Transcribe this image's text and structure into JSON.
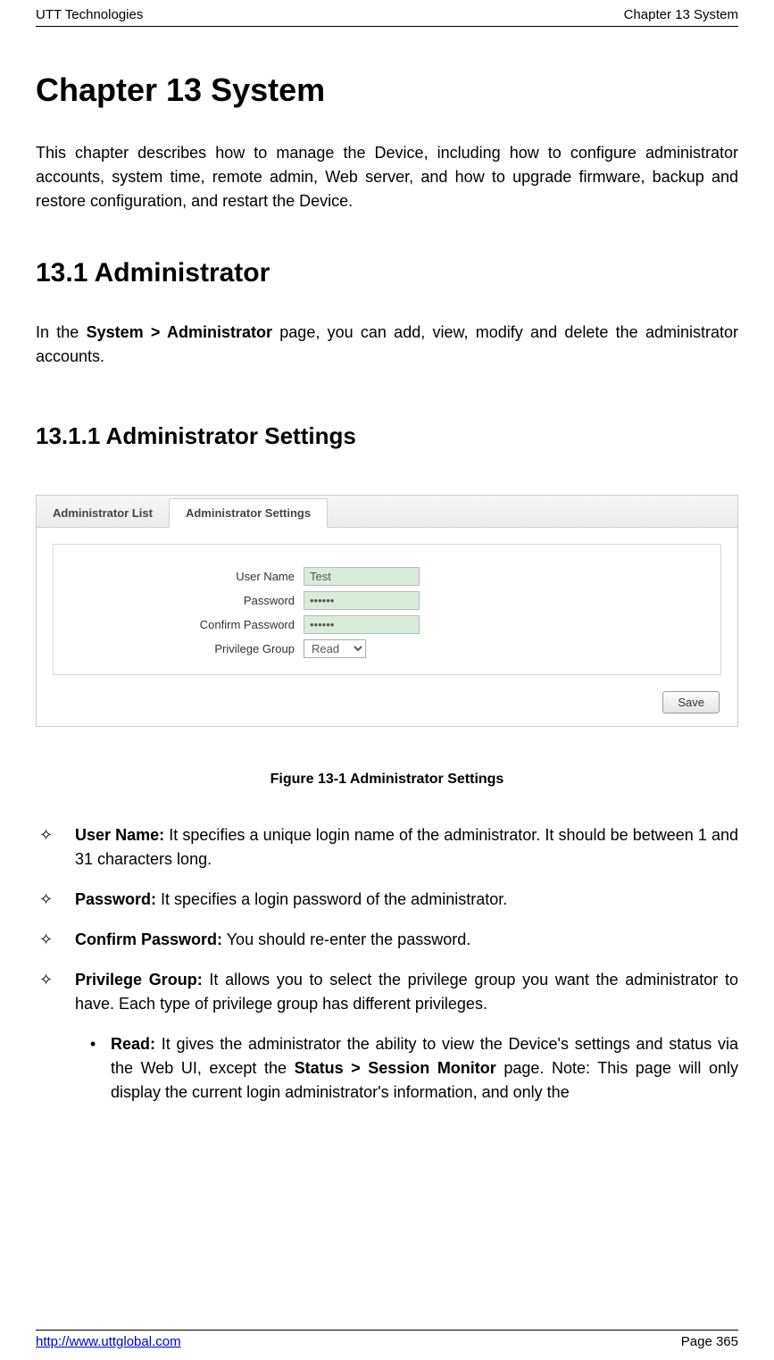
{
  "header": {
    "left": "UTT Technologies",
    "right": "Chapter 13 System"
  },
  "h1": "Chapter 13  System",
  "intro": "This chapter describes how to manage the Device, including how to configure administrator accounts, system time, remote admin, Web server, and how to upgrade firmware, backup and restore configuration, and restart the Device.",
  "h2": "13.1   Administrator",
  "section_intro_pre": "In the ",
  "section_intro_bold": "System > Administrator",
  "section_intro_post": " page, you can add, view, modify and delete the administrator accounts.",
  "h3": "13.1.1  Administrator Settings",
  "widget": {
    "tabs": {
      "list": "Administrator List",
      "settings": "Administrator Settings"
    },
    "fields": {
      "username_label": "User Name",
      "username_value": "Test",
      "password_label": "Password",
      "password_value": "••••••",
      "confirm_label": "Confirm Password",
      "confirm_value": "••••••",
      "group_label": "Privilege Group",
      "group_value": "Read"
    },
    "save": "Save"
  },
  "figure_caption": "Figure 13-1 Administrator Settings",
  "bullets": {
    "b1_bold": "User Name:",
    "b1_text": " It specifies a unique login name of the administrator. It should be between 1 and 31 characters long.",
    "b2_bold": "Password:",
    "b2_text": " It specifies a login password of the administrator.",
    "b3_bold": "Confirm Password:",
    "b3_text": " You should re-enter the password.",
    "b4_bold": "Privilege Group:",
    "b4_text": " It allows you to select the privilege group you want the administrator to have. Each type of privilege group has different privileges.",
    "sub1_bold": "Read:",
    "sub1_text1": " It gives the administrator the ability to view the Device's settings and status via the Web UI, except the ",
    "sub1_bold2": "Status > Session Monitor",
    "sub1_text2": " page. Note: This page will only display the current login administrator's information, and only the"
  },
  "footer": {
    "link": "http://www.uttglobal.com",
    "page": "Page 365"
  }
}
